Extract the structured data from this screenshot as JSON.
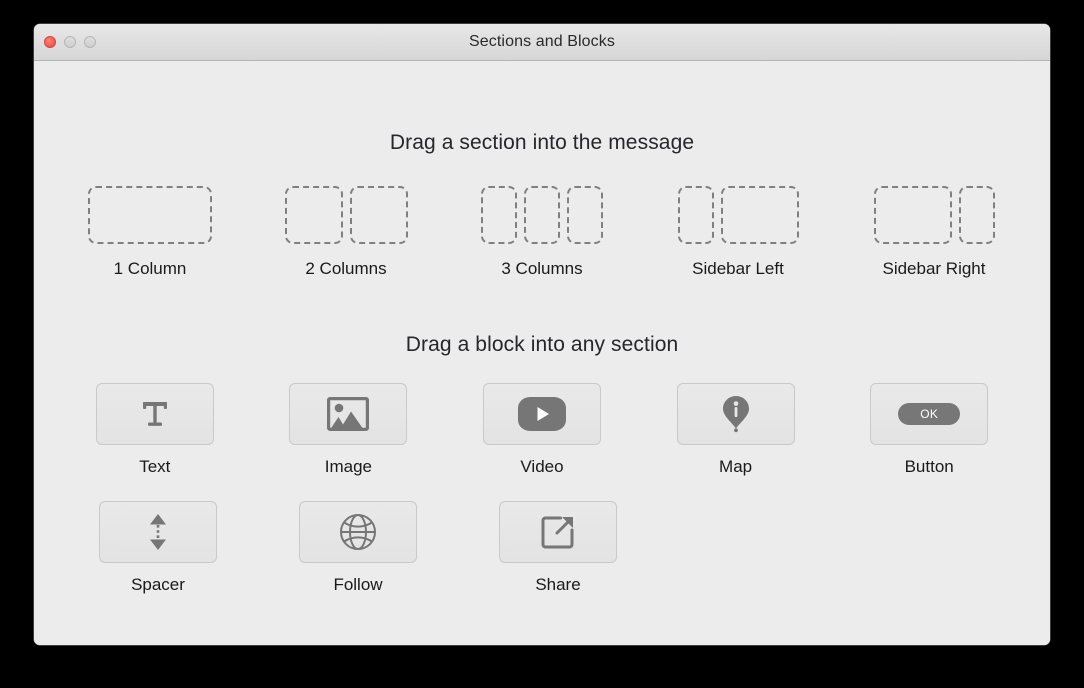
{
  "window": {
    "title": "Sections and Blocks",
    "traffic_lights": [
      {
        "name": "close-button",
        "color": "#f8554c"
      },
      {
        "name": "minimize-button",
        "color": "#d4d4d4"
      },
      {
        "name": "maximize-button",
        "color": "#d4d4d4"
      }
    ]
  },
  "sections": {
    "heading": "Drag a section into the message",
    "items": [
      {
        "label": "1 Column",
        "icon": "one-column-icon",
        "boxes": [
          "w-full"
        ]
      },
      {
        "label": "2 Columns",
        "icon": "two-columns-icon",
        "boxes": [
          "w-half",
          "w-half"
        ]
      },
      {
        "label": "3 Columns",
        "icon": "three-columns-icon",
        "boxes": [
          "w-third",
          "w-third",
          "w-third"
        ]
      },
      {
        "label": "Sidebar Left",
        "icon": "sidebar-left-icon",
        "boxes": [
          "w-narrow",
          "w-wide"
        ]
      },
      {
        "label": "Sidebar Right",
        "icon": "sidebar-right-icon",
        "boxes": [
          "w-wide",
          "w-narrow"
        ]
      }
    ]
  },
  "blocks": {
    "heading": "Drag a block into any section",
    "items": [
      {
        "label": "Text",
        "icon": "text-icon"
      },
      {
        "label": "Image",
        "icon": "image-icon"
      },
      {
        "label": "Video",
        "icon": "video-play-icon"
      },
      {
        "label": "Map",
        "icon": "map-pin-icon"
      },
      {
        "label": "Button",
        "icon": "button-icon",
        "button_text": "OK"
      },
      {
        "label": "Spacer",
        "icon": "spacer-arrows-icon"
      },
      {
        "label": "Follow",
        "icon": "globe-icon"
      },
      {
        "label": "Share",
        "icon": "share-arrow-icon"
      }
    ]
  },
  "colors": {
    "window_background": "#ececec",
    "titlebar_top": "#e8e8e8",
    "titlebar_bottom": "#d6d6d6",
    "dashed_outline": "#808080",
    "tile_fill": "#e6e6e6",
    "tile_border": "#c9c9c9",
    "icon_gray": "#767676",
    "text_dark": "#1a1a1a"
  }
}
